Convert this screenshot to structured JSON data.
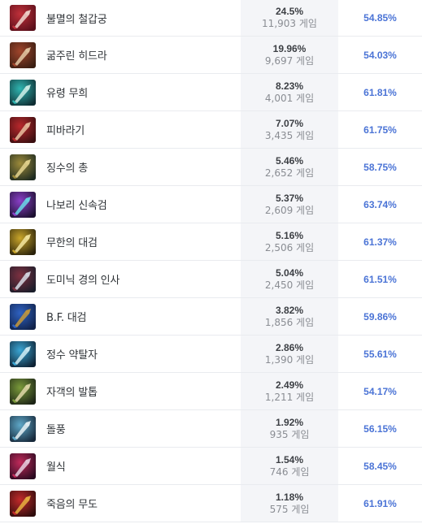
{
  "items": [
    {
      "name": "불멸의 철갑궁",
      "pick_rate": "24.5%",
      "games": "11,903 게임",
      "win_rate": "54.85%",
      "icon": "immortal-shieldbow-icon",
      "colors": [
        "#5a0f1a",
        "#c0303a",
        "#f2d8d0"
      ]
    },
    {
      "name": "굶주린 히드라",
      "pick_rate": "19.96%",
      "games": "9,697 게임",
      "win_rate": "54.03%",
      "icon": "ravenous-hydra-icon",
      "colors": [
        "#3a1e12",
        "#a0452c",
        "#e4c9a6"
      ]
    },
    {
      "name": "유령 무희",
      "pick_rate": "8.23%",
      "games": "4,001 게임",
      "win_rate": "61.81%",
      "icon": "phantom-dancer-icon",
      "colors": [
        "#0f2e33",
        "#2fb5b0",
        "#d0f0e8"
      ]
    },
    {
      "name": "피바라기",
      "pick_rate": "7.07%",
      "games": "3,435 게임",
      "win_rate": "61.75%",
      "icon": "bloodthirster-icon",
      "colors": [
        "#3a0e10",
        "#b8282c",
        "#e9c0a0"
      ]
    },
    {
      "name": "징수의 총",
      "pick_rate": "5.46%",
      "games": "2,652 게임",
      "win_rate": "58.75%",
      "icon": "the-collector-icon",
      "colors": [
        "#1d2a20",
        "#9c8a3a",
        "#e6d690"
      ]
    },
    {
      "name": "나보리 신속검",
      "pick_rate": "5.37%",
      "games": "2,609 게임",
      "win_rate": "63.74%",
      "icon": "navori-quickblades-icon",
      "colors": [
        "#1c1030",
        "#8a3fc8",
        "#6ad8e8"
      ]
    },
    {
      "name": "무한의 대검",
      "pick_rate": "5.16%",
      "games": "2,506 게임",
      "win_rate": "61.37%",
      "icon": "infinity-edge-icon",
      "colors": [
        "#2a220a",
        "#c9a52a",
        "#f4e6a0"
      ]
    },
    {
      "name": "도미닉 경의 인사",
      "pick_rate": "5.04%",
      "games": "2,450 게임",
      "win_rate": "61.51%",
      "icon": "lord-dominiks-regards-icon",
      "colors": [
        "#1a1d2a",
        "#7d3040",
        "#d8dce6"
      ]
    },
    {
      "name": "B.F. 대검",
      "pick_rate": "3.82%",
      "games": "1,856 게임",
      "win_rate": "59.86%",
      "icon": "bf-sword-icon",
      "colors": [
        "#10224a",
        "#2f62c2",
        "#c89a3a"
      ]
    },
    {
      "name": "정수 약탈자",
      "pick_rate": "2.86%",
      "games": "1,390 게임",
      "win_rate": "55.61%",
      "icon": "essence-reaver-icon",
      "colors": [
        "#0e2234",
        "#3aa6d4",
        "#d2eef6"
      ]
    },
    {
      "name": "자객의 발톱",
      "pick_rate": "2.49%",
      "games": "1,211 게임",
      "win_rate": "54.17%",
      "icon": "assassins-claw-icon",
      "colors": [
        "#1c2416",
        "#7a9a3a",
        "#e0d8a8"
      ]
    },
    {
      "name": "돌풍",
      "pick_rate": "1.92%",
      "games": "935 게임",
      "win_rate": "56.15%",
      "icon": "galeforce-icon",
      "colors": [
        "#16283a",
        "#5ea8c8",
        "#e6f2f6"
      ]
    },
    {
      "name": "월식",
      "pick_rate": "1.54%",
      "games": "746 게임",
      "win_rate": "58.45%",
      "icon": "eclipse-icon",
      "colors": [
        "#2a0a20",
        "#c02a5a",
        "#e8d0e0"
      ]
    },
    {
      "name": "죽음의 무도",
      "pick_rate": "1.18%",
      "games": "575 게임",
      "win_rate": "61.91%",
      "icon": "deaths-dance-icon",
      "colors": [
        "#2e0c0c",
        "#c22a2a",
        "#e8b040"
      ]
    }
  ]
}
